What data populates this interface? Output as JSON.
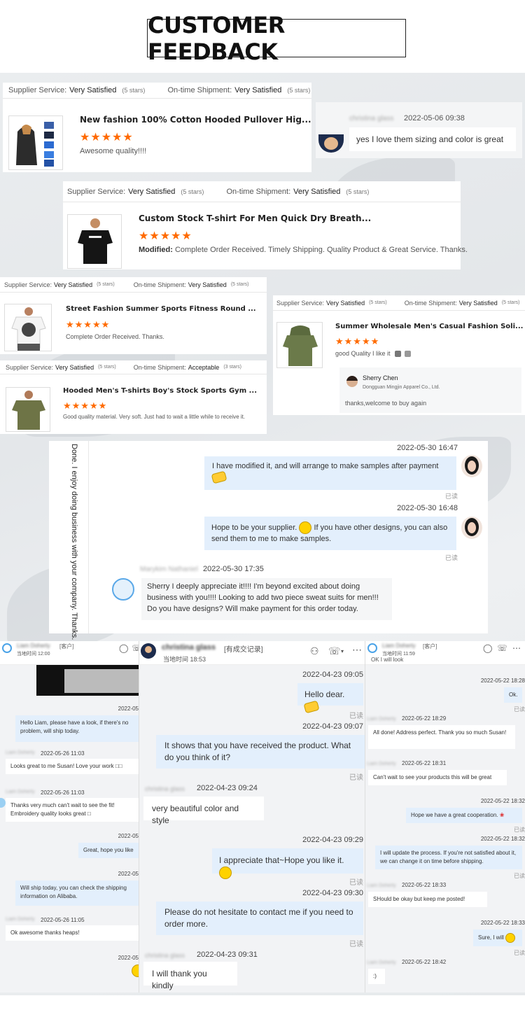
{
  "title": "CUSTOMER FEEDBACK",
  "colors": {
    "star": "#ff6a00",
    "bubble_me": "#e3effc",
    "bubble_other": "#f5f6f7"
  },
  "labels": {
    "supplier_service": "Supplier Service:",
    "ontime_shipment": "On-time Shipment:",
    "very_satisfied": "Very Satisfied",
    "acceptable": "Acceptable",
    "five_stars": "(5 stars)",
    "three_stars": "(3 stars)",
    "stars_glyph": "★★★★★",
    "read": "已读",
    "modified_label": "Modified:"
  },
  "reviews": [
    {
      "product": "New fashion 100% Cotton Hooded Pullover Hig...",
      "text": "Awesome quality!!!!"
    },
    {
      "product": "Custom Stock T-shirt For Men Quick Dry Breath...",
      "text": "Complete Order Received. Timely Shipping. Quality Product & Great Service. Thanks."
    },
    {
      "product": "Street Fashion Summer Sports Fitness Round ...",
      "text": "Complete Order Received. Thanks."
    },
    {
      "product": "Summer Wholesale Men's Casual Fashion Soli...",
      "text": "good  Quality I like it",
      "reply_name": "Sherry Chen",
      "reply_company": "Dongguan Mingjin Apparel Co., Ltd.",
      "reply_text": "thanks,welcome to buy again"
    },
    {
      "product": "Hooded Men's T-shirts Boy's Stock Sports Gym ...",
      "text": "Good quality material. Very soft. Just had to wait a little while to receive it."
    }
  ],
  "chat1": {
    "name": "christina glass",
    "time": "2022-05-06 09:38",
    "text": "yes I love them sizing and color is great"
  },
  "chat2": {
    "side_text": "Done. I enjoy doing business with your company. Thanks.",
    "msg1_time": "2022-05-30 16:47",
    "msg1": "I have modified it, and will arrange to make samples after payment",
    "msg2_time": "2022-05-30 16:48",
    "msg2a": "Hope to be your supplier.",
    "msg2b": "If you have other designs, you can also send them to me to make samples.",
    "msg3_name": "Marykim Nathaniel",
    "msg3_time": "2022-05-30 17:35",
    "msg3": "Sherry I deeply appreciate it!!!! I'm beyond excited about doing business with you!!!! Looking to add two piece sweat suits for men!!! Do you have designs? Will make payment for this order today."
  },
  "screen_left": {
    "name": "Liam Doherty",
    "tag": "[客户]",
    "local_time": "当地时间 12:00",
    "messages": [
      {
        "time": "2022-05",
        "text": "Hello Liam, please have a look, if there's no problem, will ship today."
      },
      {
        "name": "Liam Doherty",
        "time": "2022-05-26 11:03",
        "text": "Looks great to me Susan! Love your work □□"
      },
      {
        "name": "Liam Doherty",
        "time": "2022-05-26 11:03",
        "text": "Thanks very much can't wait to see the fit! Embroidery quality looks great □"
      },
      {
        "time": "2022-05",
        "text": "Great, hope you like"
      },
      {
        "time": "2022-05",
        "text": "Will ship today, you can check the shipping information on Alibaba."
      },
      {
        "name": "Liam Doherty",
        "time": "2022-05-26 11:05",
        "text": "Ok awesome thanks heaps!"
      },
      {
        "time": "2022-05"
      }
    ]
  },
  "screen_mid": {
    "name": "christina glass",
    "tag": "[有成交记录]",
    "local_time": "当地时间 18:53",
    "messages": [
      {
        "time": "2022-04-23 09:05",
        "text": "Hello dear."
      },
      {
        "time": "2022-04-23 09:07",
        "text": "It shows that you have received the product. What do you think of it?"
      },
      {
        "name": "christina glass",
        "time": "2022-04-23 09:24",
        "text": "very beautiful color and style"
      },
      {
        "time": "2022-04-23 09:29",
        "text": "I appreciate that~Hope you like it."
      },
      {
        "time": "2022-04-23 09:30",
        "text": "Please do not hesitate to contact me if you need to order more."
      },
      {
        "name": "christina glass",
        "time": "2022-04-23 09:31",
        "text": "I will thank you kindly"
      }
    ]
  },
  "screen_right": {
    "name": "Liam Doherty",
    "tag": "[客户]",
    "local_time": "当地时间 11:59",
    "top_text": "OK I will look",
    "messages": [
      {
        "time": "2022-05-22 18:28",
        "text": "Ok."
      },
      {
        "name": "Liam Doherty",
        "time": "2022-05-22 18:29",
        "text": "All done! Address perfect. Thank you so much Susan!"
      },
      {
        "name": "Liam Doherty",
        "time": "2022-05-22 18:31",
        "text": "Can't wait to see your products this will be great"
      },
      {
        "time": "2022-05-22 18:32",
        "text": "Hope we have a great cooperation."
      },
      {
        "time": "2022-05-22 18:32",
        "text": "I will update the process. If you're not satisfied about it, we can change it on time before shipping."
      },
      {
        "name": "Liam Doherty",
        "time": "2022-05-22 18:33",
        "text": "SHould be okay but keep me posted!"
      },
      {
        "time": "2022-05-22 18:33",
        "text": "Sure, I will"
      },
      {
        "name": "Liam Doherty",
        "time": "2022-05-22 18:42",
        "text": ":)"
      }
    ]
  }
}
